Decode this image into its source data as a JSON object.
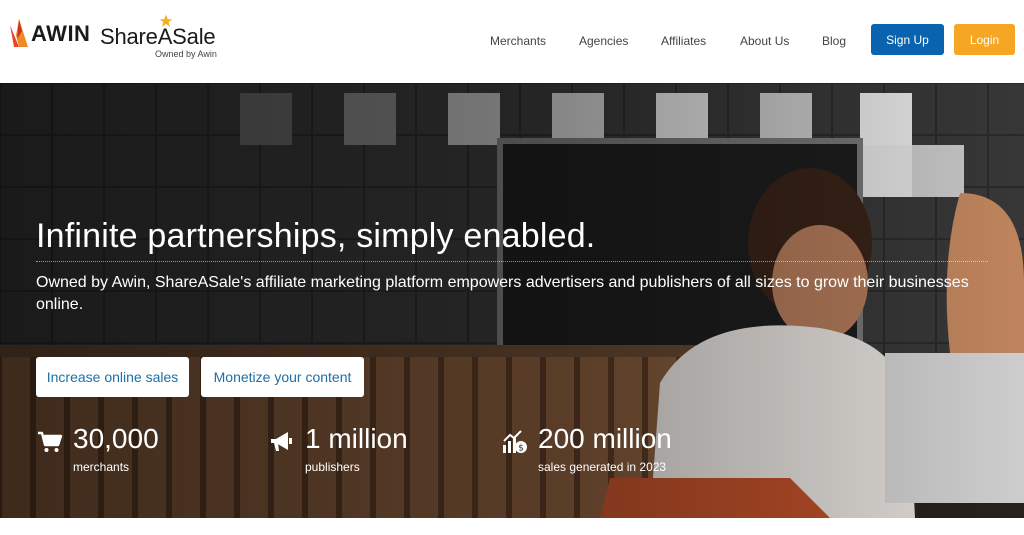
{
  "header": {
    "awin_logo": {
      "text": "AWIN",
      "icon": "awin-flame-icon"
    },
    "shareasale_logo": {
      "text": "ShareASale",
      "tagline": "Owned by Awin",
      "icon": "star-icon"
    },
    "nav": [
      {
        "label": "Merchants"
      },
      {
        "label": "Agencies"
      },
      {
        "label": "Affiliates"
      },
      {
        "label": "About Us"
      },
      {
        "label": "Blog"
      }
    ],
    "signup_label": "Sign Up",
    "login_label": "Login"
  },
  "hero": {
    "title": "Infinite partnerships, simply enabled.",
    "subtitle": "Owned by Awin, ShareASale's affiliate marketing platform empowers advertisers and publishers of all sizes to grow their businesses online.",
    "cta_primary": "Increase online sales",
    "cta_secondary": "Monetize your content",
    "stats": [
      {
        "icon": "cart-icon",
        "value": "30,000",
        "label": "merchants"
      },
      {
        "icon": "megaphone-icon",
        "value": "1 million",
        "label": "publishers"
      },
      {
        "icon": "growth-chart-icon",
        "value": "200 million",
        "label": "sales generated in 2023"
      }
    ]
  },
  "colors": {
    "signup_bg": "#0a63ae",
    "login_bg": "#f5a623",
    "cta_text": "#1d6fa5",
    "awin_flame_red": "#e8452c",
    "awin_flame_orange": "#f5a623",
    "star_gold": "#f2b01e"
  }
}
